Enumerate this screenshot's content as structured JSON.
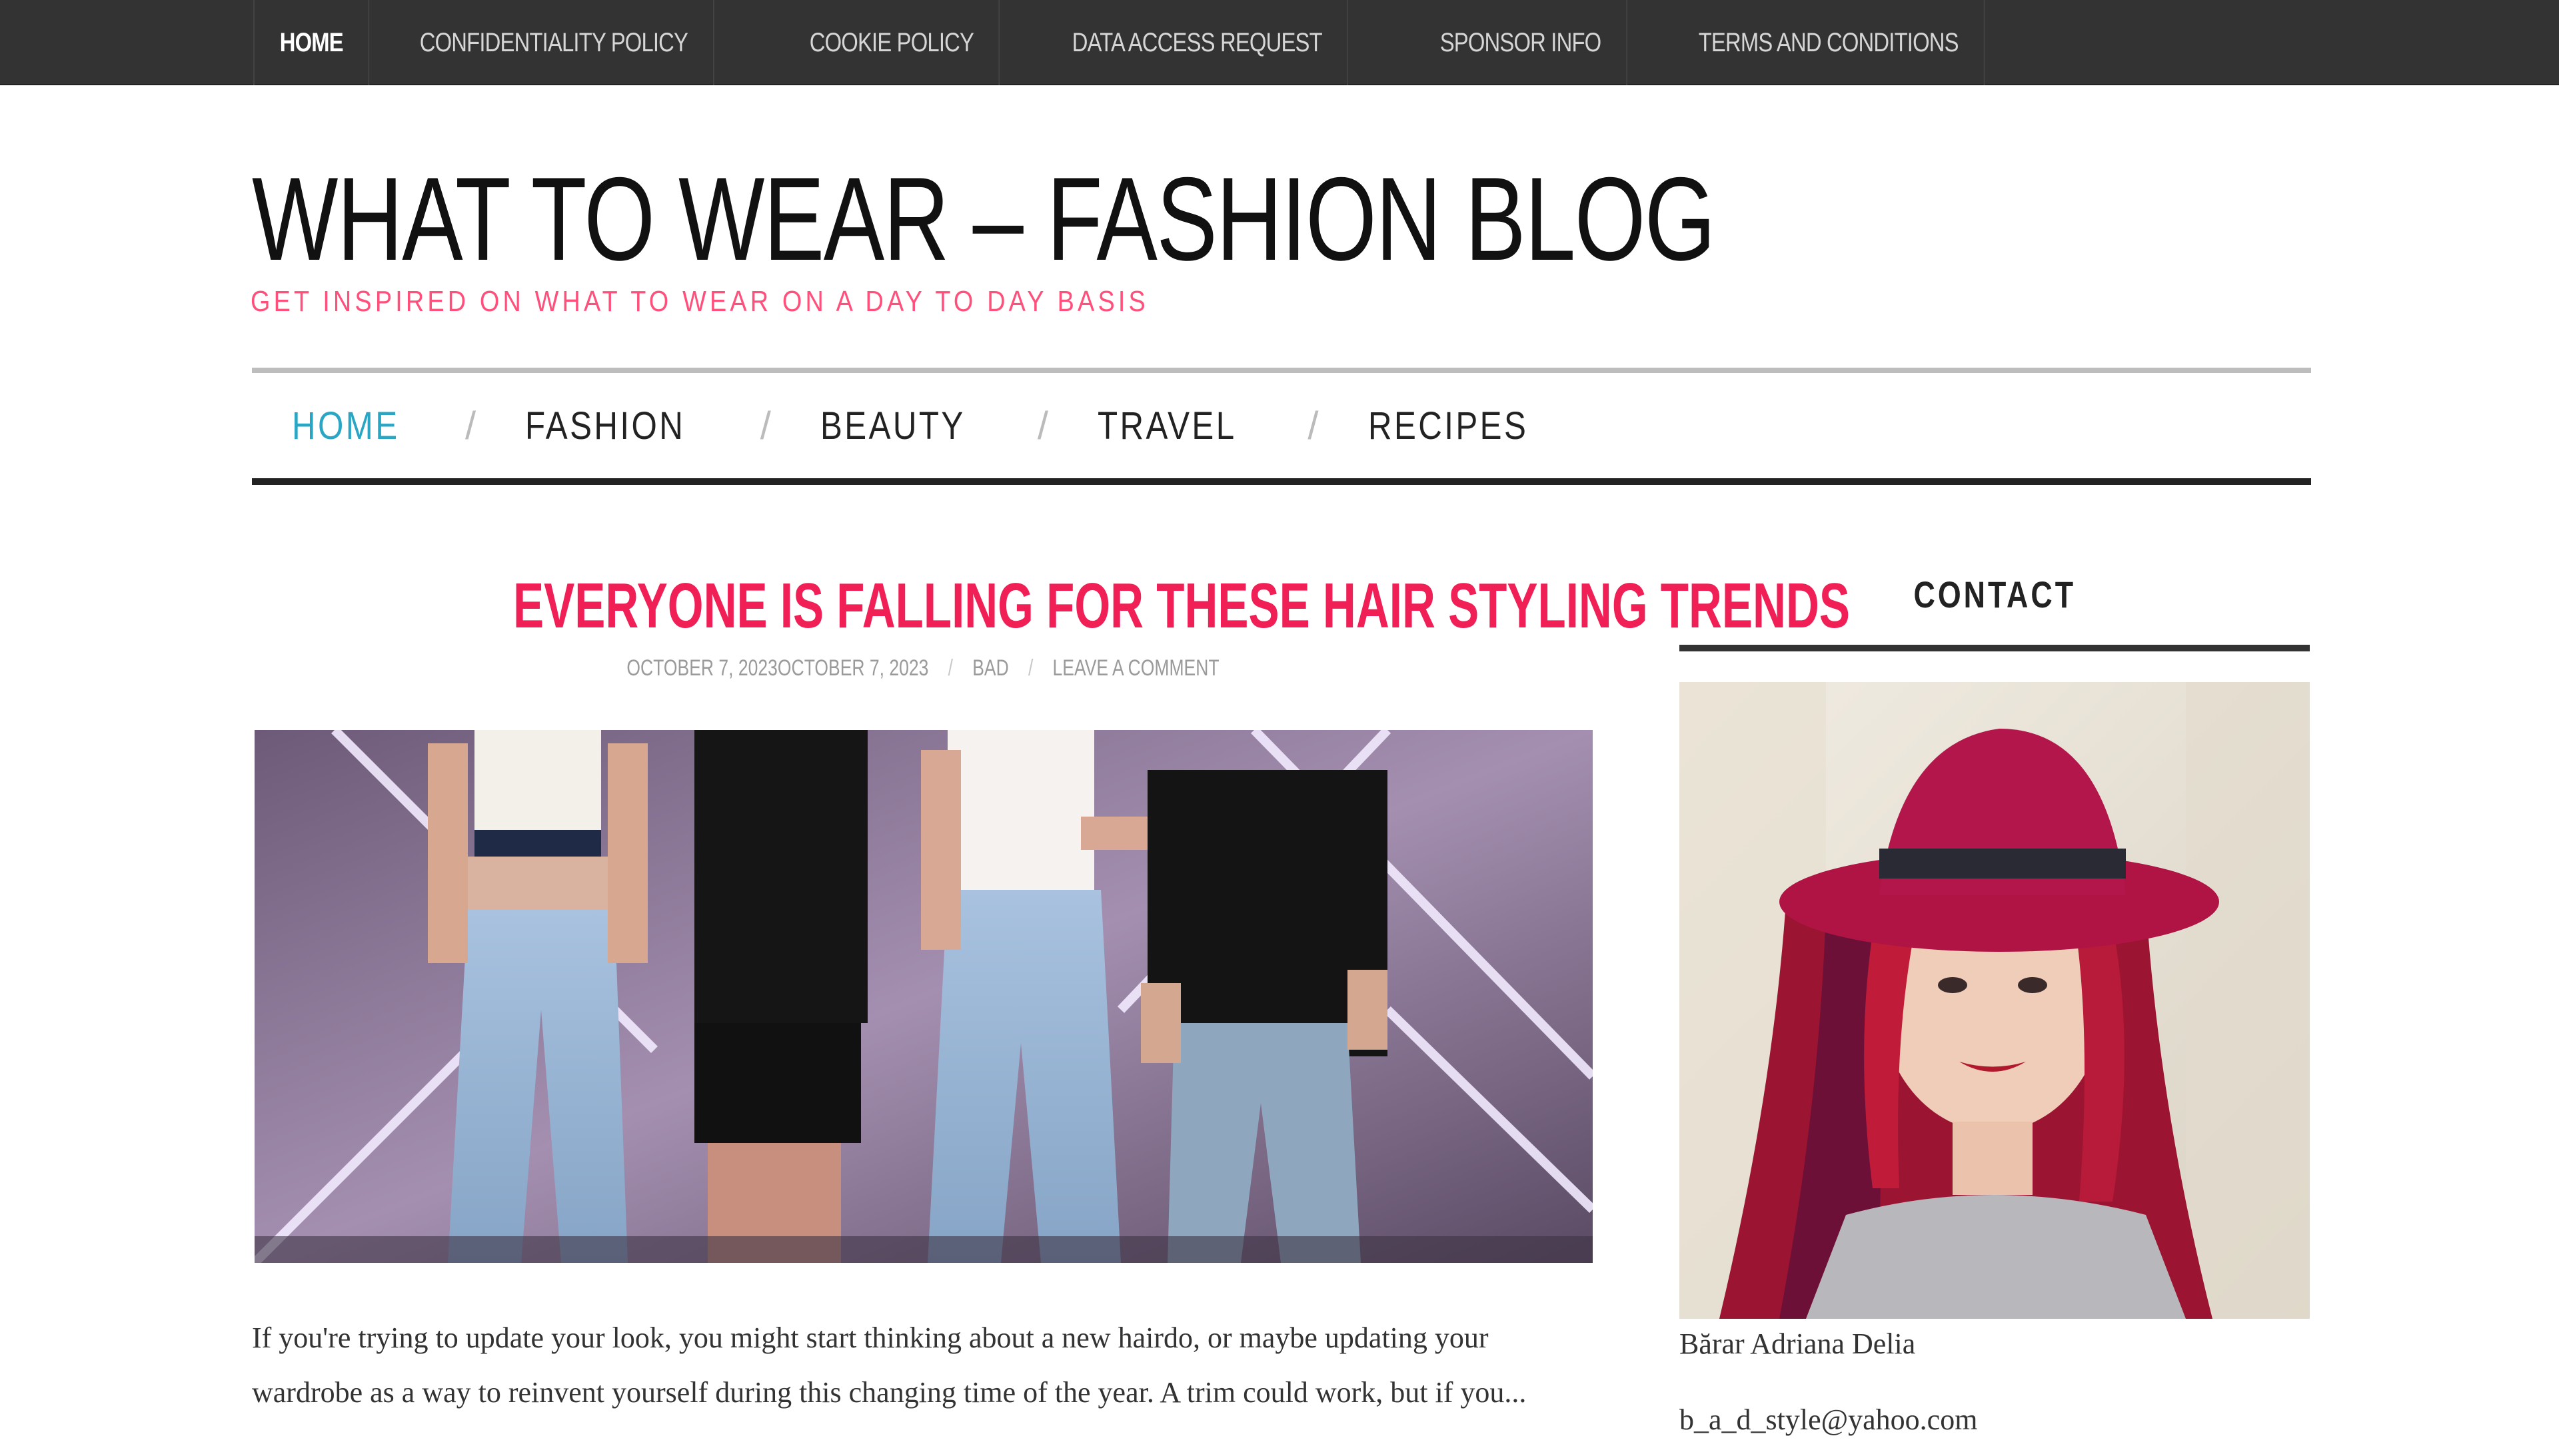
{
  "topbar": {
    "items": [
      {
        "label": "HOME"
      },
      {
        "label": "CONFIDENTIALITY POLICY"
      },
      {
        "label": "COOKIE POLICY"
      },
      {
        "label": "DATA ACCESS REQUEST"
      },
      {
        "label": "SPONSOR INFO"
      },
      {
        "label": "TERMS AND CONDITIONS"
      }
    ]
  },
  "header": {
    "title": "WHAT TO WEAR – FASHION BLOG",
    "tagline": "GET INSPIRED ON WHAT TO WEAR ON A DAY TO DAY BASIS"
  },
  "mainnav": {
    "items": [
      {
        "label": "HOME"
      },
      {
        "label": "FASHION"
      },
      {
        "label": "BEAUTY"
      },
      {
        "label": "TRAVEL"
      },
      {
        "label": "RECIPES"
      }
    ],
    "separator": "/"
  },
  "post": {
    "title": "EVERYONE IS FALLING FOR THESE HAIR STYLING TRENDS",
    "date": "OCTOBER 7, 2023OCTOBER 7, 2023",
    "author": "BAD",
    "comment_link": "LEAVE A COMMENT",
    "excerpt": "If you're trying to update your look, you might start thinking about a new hairdo, or maybe updating your wardrobe as a way to reinvent yourself during this changing time of the year. A trim could work, but if you..."
  },
  "sidebar": {
    "widget_title": "CONTACT",
    "name": "Bărar Adriana Delia",
    "email": "b_a_d_style@yahoo.com"
  },
  "colors": {
    "topbar_bg": "#333333",
    "accent_pink": "#f01f55",
    "tagline_pink": "#ff4f7b",
    "nav_active": "#2aa6c4"
  }
}
